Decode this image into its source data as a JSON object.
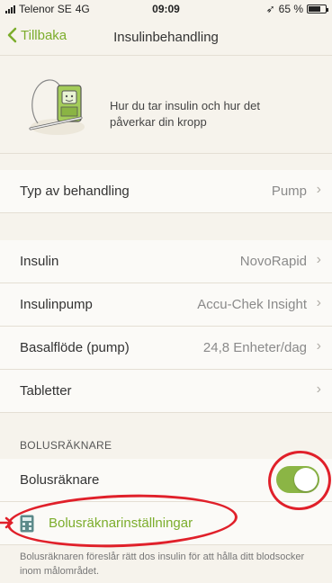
{
  "status_bar": {
    "carrier": "Telenor SE",
    "network": "4G",
    "time": "09:09",
    "battery": "65 %"
  },
  "nav": {
    "back_label": "Tillbaka",
    "title": "Insulinbehandling"
  },
  "hero": {
    "text": "Hur du tar insulin och hur det påverkar din kropp",
    "illustration_icon": "insulin-pump-illustration"
  },
  "rows": {
    "treatment": {
      "label": "Typ av behandling",
      "value": "Pump"
    },
    "insulin": {
      "label": "Insulin",
      "value": "NovoRapid"
    },
    "pump": {
      "label": "Insulinpump",
      "value": "Accu-Chek Insight"
    },
    "basal": {
      "label": "Basalflöde (pump)",
      "value": "24,8 Enheter/dag"
    },
    "tablets": {
      "label": "Tabletter",
      "value": ""
    }
  },
  "bolus": {
    "section_header": "BOLUSRÄKNARE",
    "toggle_label": "Bolusräknare",
    "toggle_on": true,
    "settings_label": "Bolusräknarinställningar",
    "footer": "Bolusräknaren föreslår rätt dos insulin för att hålla ditt blodsocker inom målområdet."
  },
  "colors": {
    "accent": "#7cad2c",
    "toggle_on": "#8bb545",
    "highlight": "#e0202a",
    "background": "#f6f3ec"
  }
}
